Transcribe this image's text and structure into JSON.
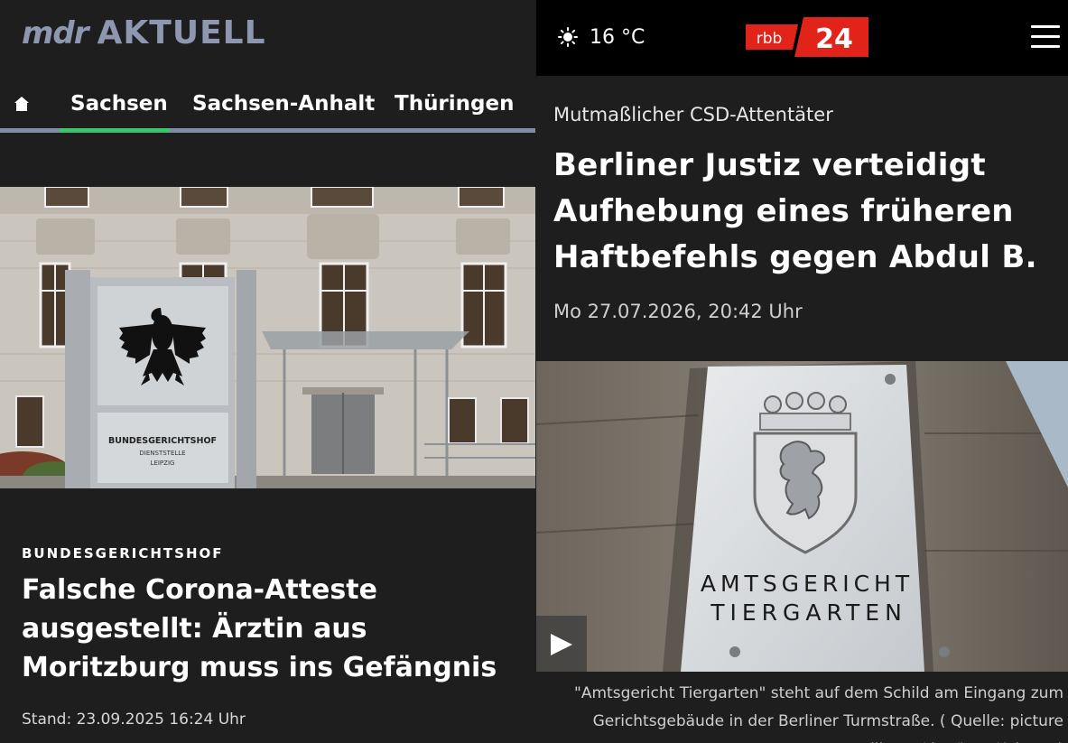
{
  "left_panel": {
    "logo": {
      "brand": "mdr",
      "section": "AKTUELL"
    },
    "nav": {
      "home_icon": "home-icon",
      "tabs": [
        "Sachsen",
        "Sachsen-Anhalt",
        "Thüringen"
      ],
      "active_tab": "Sachsen"
    },
    "image": {
      "sign_line1": "BUNDESGERICHTSHOF",
      "sign_line2": "DIENSTSTELLE",
      "sign_line3": "LEIPZIG"
    },
    "article": {
      "kicker": "BUNDESGERICHTSHOF",
      "headline": "Falsche Corona-Atteste ausgestellt: Ärztin aus Moritzburg muss ins Gefängnis",
      "date": "Stand: 23.09.2025 16:24 Uhr"
    }
  },
  "right_panel": {
    "weather": {
      "icon": "sun-icon",
      "temperature": "16 °C"
    },
    "logo": {
      "part1": "rbb",
      "part2": "24"
    },
    "menu_icon": "hamburger-menu-icon",
    "article": {
      "kicker": "Mutmaßlicher CSD-Attentäter",
      "headline": "Berliner Justiz verteidigt Aufhebung eines früheren Haftbefehls gegen Abdul B.",
      "date": "Mo 27.07.2026, 20:42 Uhr"
    },
    "image": {
      "sign_line1": "AMTSGERICHT",
      "sign_line2": "TIERGARTEN"
    },
    "play_icon": "play-icon",
    "caption": {
      "line1": "\"Amtsgericht Tiergarten\" steht auf dem Schild am Eingang zum",
      "line2": "Gerichtsgebäude in der Berliner Turmstraße. ( Quelle: picture",
      "line3": "alliance/dpa/Jens Kalaene)"
    }
  },
  "colors": {
    "mdr_logo": "#8e97b0",
    "mdr_nav_rule": "#7f8baa",
    "mdr_active": "#3bc46b",
    "rbb_red": "#e2231a",
    "background": "#1e1e1e"
  }
}
